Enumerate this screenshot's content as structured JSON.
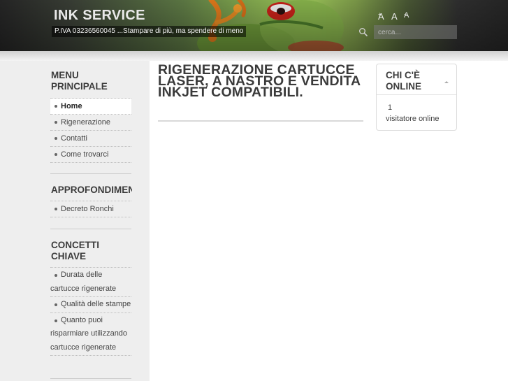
{
  "header": {
    "site_title": "INK SERVICE",
    "slogan": "P.IVA 03236560045 ...Stampare di più, ma spendere di meno",
    "font_controls": {
      "increase_label": "A",
      "increase_mark": "+",
      "reset_label": "A",
      "decrease_label": "A",
      "decrease_mark": "−"
    },
    "search": {
      "placeholder": "cerca..."
    }
  },
  "left_sidebar": {
    "main_menu": {
      "title": "MENU PRINCIPALE",
      "items": [
        {
          "label": "Home",
          "active": true
        },
        {
          "label": "Rigenerazione",
          "active": false
        },
        {
          "label": "Contatti",
          "active": false
        },
        {
          "label": "Come trovarci",
          "active": false
        }
      ]
    },
    "approfondimenti": {
      "title": "APPROFONDIMENTI",
      "items": [
        {
          "label": "Decreto Ronchi"
        }
      ]
    },
    "concetti_chiave": {
      "title": "CONCETTI CHIAVE",
      "items": [
        {
          "label": "Durata delle cartucce rigenerate"
        },
        {
          "label": "Qualità delle stampe"
        },
        {
          "label": "Quanto puoi risparmiare utilizzando cartucce rigenerate"
        }
      ]
    }
  },
  "main": {
    "title": "RIGENERAZIONE CARTUCCE LASER, A NASTRO E VENDITA INKJET COMPATIBILI."
  },
  "right_sidebar": {
    "online_module": {
      "title": "CHI C'È ONLINE",
      "count": "1",
      "label": "visitatore online"
    }
  },
  "colors": {
    "header_dark": "#262626",
    "header_green": "#8fb753",
    "sidebar_bg": "#eeeeee",
    "text_dark": "#3a3a3a"
  }
}
